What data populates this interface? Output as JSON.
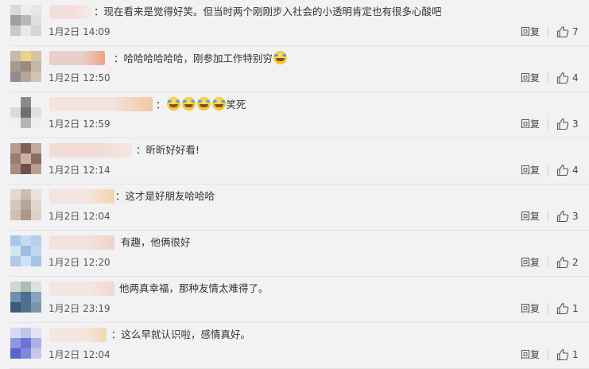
{
  "comments": [
    {
      "text": "：现在看来是觉得好笑。但当时两个刚刚步入社会的小透明肯定也有很多心酸吧",
      "emoji_count": 0,
      "suffix": "",
      "time": "1月2日 14:09",
      "reply_label": "回复",
      "likes": "7",
      "avatar_colors": [
        "#d9d9d9",
        "#eeeeee",
        "#e6e6e6",
        "#9aa3a0",
        "#b8b8b8",
        "#e0e0e0",
        "#c8c8c8",
        "#e8e8e8",
        "#d5d5d5"
      ],
      "name_colors": [
        "#f3e0dd",
        "#f7ecea"
      ]
    },
    {
      "text": "：哈哈哈哈哈哈，刚参加工作特别穷",
      "emoji_count": 1,
      "suffix": "",
      "time": "1月2日 12:50",
      "reply_label": "回复",
      "likes": "4",
      "avatar_colors": [
        "#c9b9a7",
        "#e8d48e",
        "#d7c3a7",
        "#a89a8c",
        "#9b8a7f",
        "#c2b6a8",
        "#8e8e8e",
        "#b5a79a",
        "#d0c4b5"
      ],
      "name_colors": [
        "#e8d0c9",
        "#f0a07f"
      ]
    },
    {
      "text": "：",
      "emoji_count": 4,
      "suffix": "笑死",
      "time": "1月2日 12:59",
      "reply_label": "回复",
      "likes": "3",
      "avatar_colors": [
        "#f2f2f2",
        "#8a8a8a",
        "#f2f2f2",
        "#dcdcdc",
        "#6f6f6f",
        "#e0e0e0",
        "#f0f0f0",
        "#b5b5b5",
        "#eeeeee"
      ],
      "name_colors": [
        "#f5e3de",
        "#f2c8a0"
      ]
    },
    {
      "text": "：昕昕好好看!",
      "emoji_count": 0,
      "suffix": "",
      "time": "1月2日 12:14",
      "reply_label": "回复",
      "likes": "4",
      "avatar_colors": [
        "#b59c8e",
        "#7d5f55",
        "#c2a99a",
        "#9c7b6f",
        "#c9b3a6",
        "#8a6d62",
        "#a88d80",
        "#6d524a",
        "#b89f91"
      ],
      "name_colors": [
        "#f1dcd6",
        "#f3e7e3"
      ]
    },
    {
      "text": "：这才是好朋友哈哈哈",
      "emoji_count": 0,
      "suffix": "",
      "time": "1月2日 12:04",
      "reply_label": "回复",
      "likes": "3",
      "avatar_colors": [
        "#e5d9cf",
        "#cbbcb0",
        "#ebe2da",
        "#d6c7bb",
        "#b8a597",
        "#e1d4ca",
        "#cfc0b4",
        "#a99788",
        "#ded1c6"
      ],
      "name_colors": [
        "#f4e4df",
        "#f3d6a8"
      ]
    },
    {
      "text": "有趣，他俩很好",
      "emoji_count": 0,
      "suffix": "",
      "time": "1月2日 12:20",
      "reply_label": "回复",
      "likes": "2",
      "avatar_colors": [
        "#a9c7e6",
        "#c8dbee",
        "#b6cfe8",
        "#d3e3f2",
        "#9dbfe2",
        "#c0d6ec",
        "#b0cbe6",
        "#cfe0f1",
        "#a5c3e4"
      ],
      "name_colors": [
        "#f2e1dc",
        "#efd3c7"
      ]
    },
    {
      "text": "他两真幸福，那种友情太难得了。",
      "emoji_count": 0,
      "suffix": "",
      "time": "1月2日 23:19",
      "reply_label": "回复",
      "likes": "1",
      "avatar_colors": [
        "#cfd9d4",
        "#aebdb5",
        "#d9e2dd",
        "#6e8fb0",
        "#4e6f93",
        "#8aa4b9",
        "#3c5a7c",
        "#52708f",
        "#7d95aa"
      ],
      "name_colors": [
        "#f4e6e2",
        "#f1d9d2"
      ]
    },
    {
      "text": "：这么早就认识啦，感情真好。",
      "emoji_count": 0,
      "suffix": "",
      "time": "1月2日 12:04",
      "reply_label": "回复",
      "likes": "1",
      "avatar_colors": [
        "#d6d9f0",
        "#bfc4ea",
        "#e2e4f4",
        "#8d96e0",
        "#6a76d6",
        "#aab1e6",
        "#5865cc",
        "#7f8ad8",
        "#c3c8ec"
      ],
      "name_colors": [
        "#f5e6e2",
        "#f3d8b2"
      ]
    }
  ]
}
